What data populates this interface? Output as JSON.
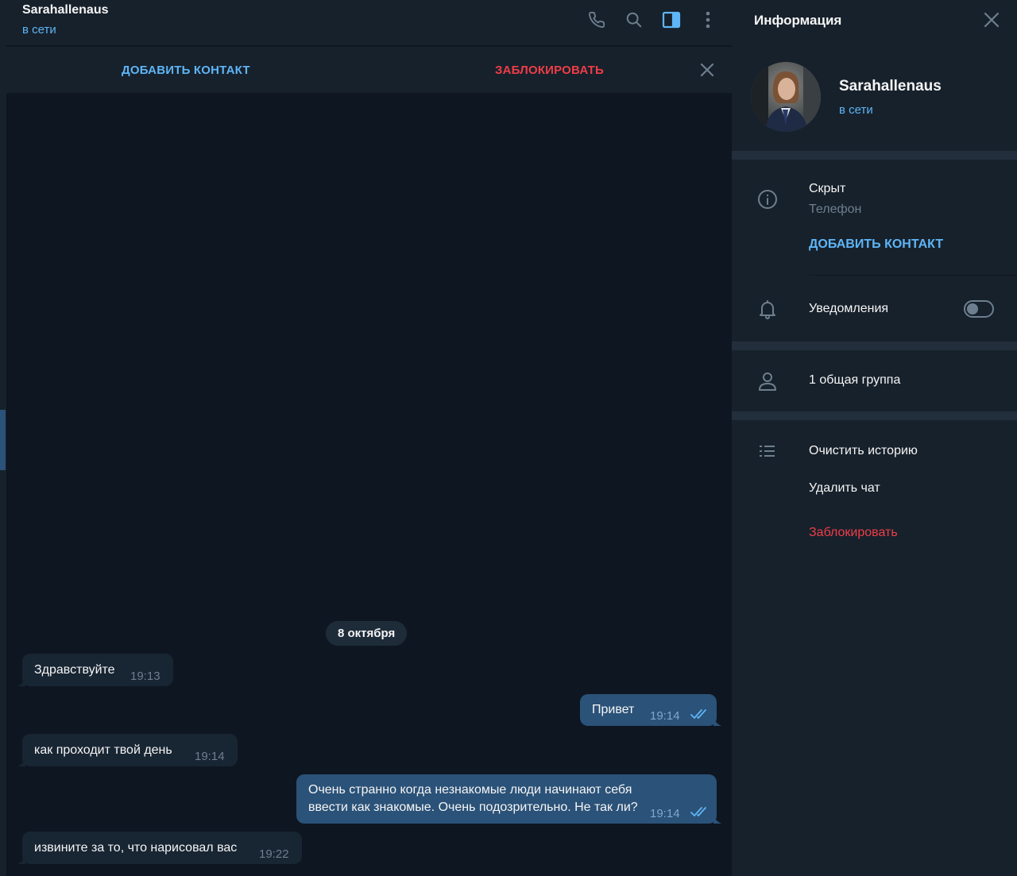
{
  "header": {
    "title": "Sarahallenaus",
    "status": "в сети",
    "icons": [
      "phone-icon",
      "search-icon",
      "sidebar-toggle-icon",
      "more-vertical-icon"
    ]
  },
  "action_bar": {
    "add_contact": "ДОБАВИТЬ КОНТАКТ",
    "block": "ЗАБЛОКИРОВАТЬ"
  },
  "chat": {
    "date_separator": "8 октября",
    "messages": [
      {
        "direction": "in",
        "text": "Здравствуйте",
        "time": "19:13"
      },
      {
        "direction": "out",
        "text": "Привет",
        "time": "19:14",
        "status": "read"
      },
      {
        "direction": "in",
        "text": "как проходит твой день",
        "time": "19:14"
      },
      {
        "direction": "out",
        "text": "Очень странно когда незнакомые люди начинают себя ввести как знакомые. Очень подозрительно. Не так ли?",
        "time": "19:14",
        "status": "read"
      },
      {
        "direction": "in",
        "text": "извините за то, что нарисовал вас",
        "time": "19:22"
      }
    ]
  },
  "info": {
    "title": "Информация",
    "profile": {
      "name": "Sarahallenaus",
      "status": "в сети"
    },
    "phone": {
      "value": "Скрыт",
      "label": "Телефон"
    },
    "add_contact": "ДОБАВИТЬ КОНТАКТ",
    "notifications": {
      "label": "Уведомления",
      "enabled": false
    },
    "common_groups": "1 общая группа",
    "actions": {
      "clear_history": "Очистить историю",
      "delete_chat": "Удалить чат",
      "block": "Заблокировать"
    }
  },
  "colors": {
    "background": "#0e1621",
    "panel": "#17212b",
    "accent": "#5eb5f7",
    "danger": "#ef3d48",
    "outgoing_bubble": "#2b5278",
    "incoming_bubble": "#182533"
  }
}
